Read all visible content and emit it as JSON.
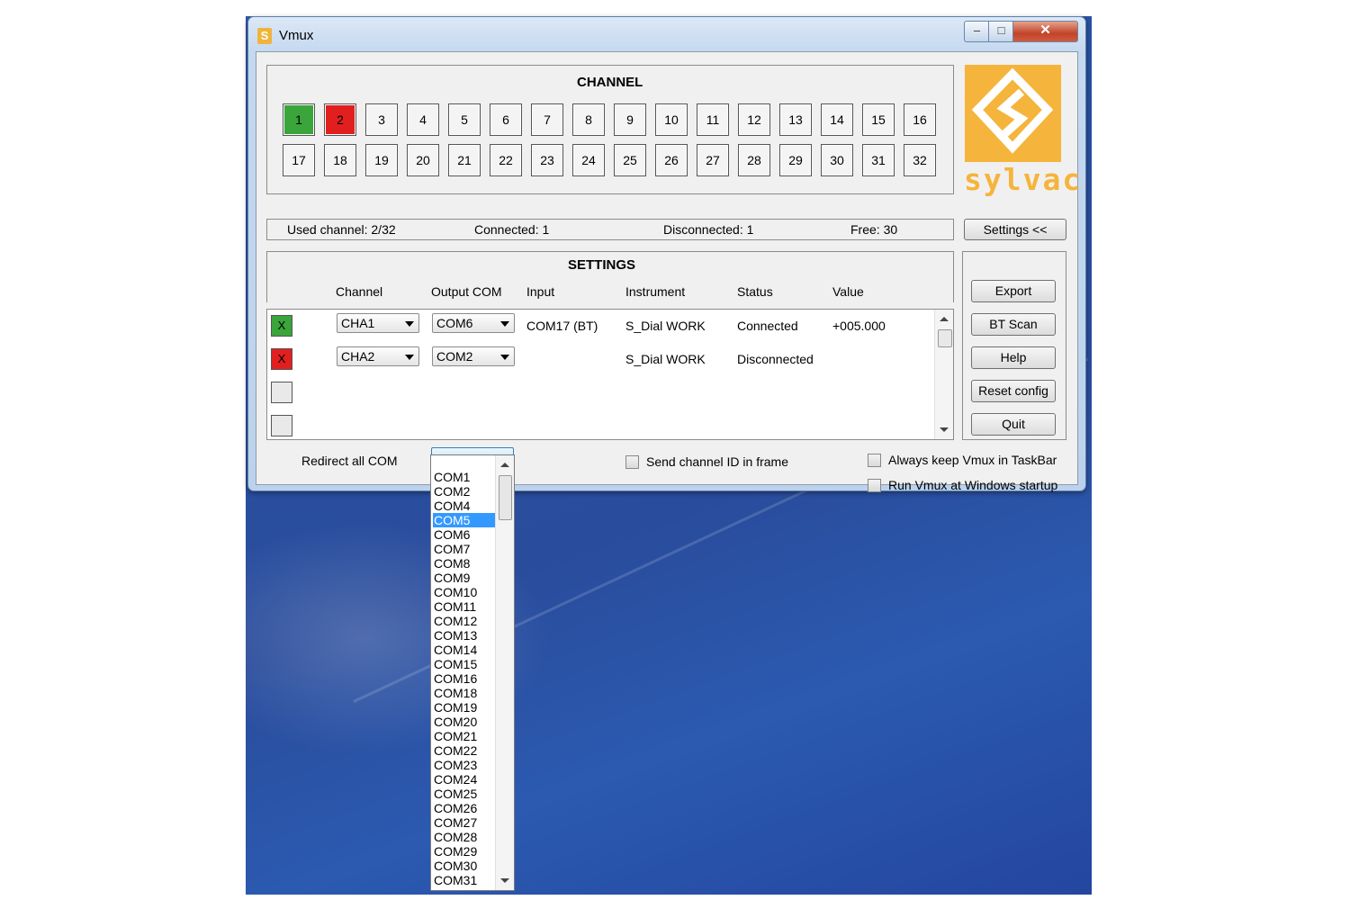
{
  "window": {
    "title": "Vmux",
    "app_icon": "S",
    "minimize": "–",
    "maximize": "□",
    "close": "✕"
  },
  "channel_panel": {
    "heading": "CHANNEL",
    "channels": [
      "1",
      "2",
      "3",
      "4",
      "5",
      "6",
      "7",
      "8",
      "9",
      "10",
      "11",
      "12",
      "13",
      "14",
      "15",
      "16",
      "17",
      "18",
      "19",
      "20",
      "21",
      "22",
      "23",
      "24",
      "25",
      "26",
      "27",
      "28",
      "29",
      "30",
      "31",
      "32"
    ],
    "green": [
      "1"
    ],
    "red": [
      "2"
    ]
  },
  "status": {
    "used": "Used channel: 2/32",
    "connected": "Connected: 1",
    "disconnected": "Disconnected: 1",
    "free": "Free: 30"
  },
  "logo": {
    "text": "sylvac"
  },
  "settings_toggle": "Settings <<",
  "settings": {
    "heading": "SETTINGS",
    "columns": [
      "Channel",
      "Output COM",
      "Input",
      "Instrument",
      "Status",
      "Value"
    ],
    "rows": [
      {
        "check": "X",
        "color": "green",
        "channel": "CHA1",
        "output": "COM6",
        "input": "COM17 (BT)",
        "instrument": "S_Dial WORK",
        "status": "Connected",
        "value": "+005.000"
      },
      {
        "check": "X",
        "color": "red",
        "channel": "CHA2",
        "output": "COM2",
        "input": "",
        "instrument": "S_Dial WORK",
        "status": "Disconnected",
        "value": ""
      }
    ]
  },
  "side_buttons": {
    "export": "Export",
    "bt_scan": "BT Scan",
    "help": "Help",
    "reset": "Reset config",
    "quit": "Quit"
  },
  "bottom": {
    "redirect_label": "Redirect all COM",
    "redirect_value": "",
    "send_channel_id": "Send channel ID in frame",
    "always_keep": "Always keep Vmux in TaskBar",
    "run_startup": "Run Vmux at Windows startup"
  },
  "dropdown": {
    "selected": "COM5",
    "options": [
      "COM1",
      "COM2",
      "COM4",
      "COM5",
      "COM6",
      "COM7",
      "COM8",
      "COM9",
      "COM10",
      "COM11",
      "COM12",
      "COM13",
      "COM14",
      "COM15",
      "COM16",
      "COM18",
      "COM19",
      "COM20",
      "COM21",
      "COM22",
      "COM23",
      "COM24",
      "COM25",
      "COM26",
      "COM27",
      "COM28",
      "COM29",
      "COM30",
      "COM31"
    ]
  },
  "colors": {
    "green": "#3aa53a",
    "red": "#e21f1f",
    "accent": "#f5b43b",
    "selection": "#3399ff"
  }
}
